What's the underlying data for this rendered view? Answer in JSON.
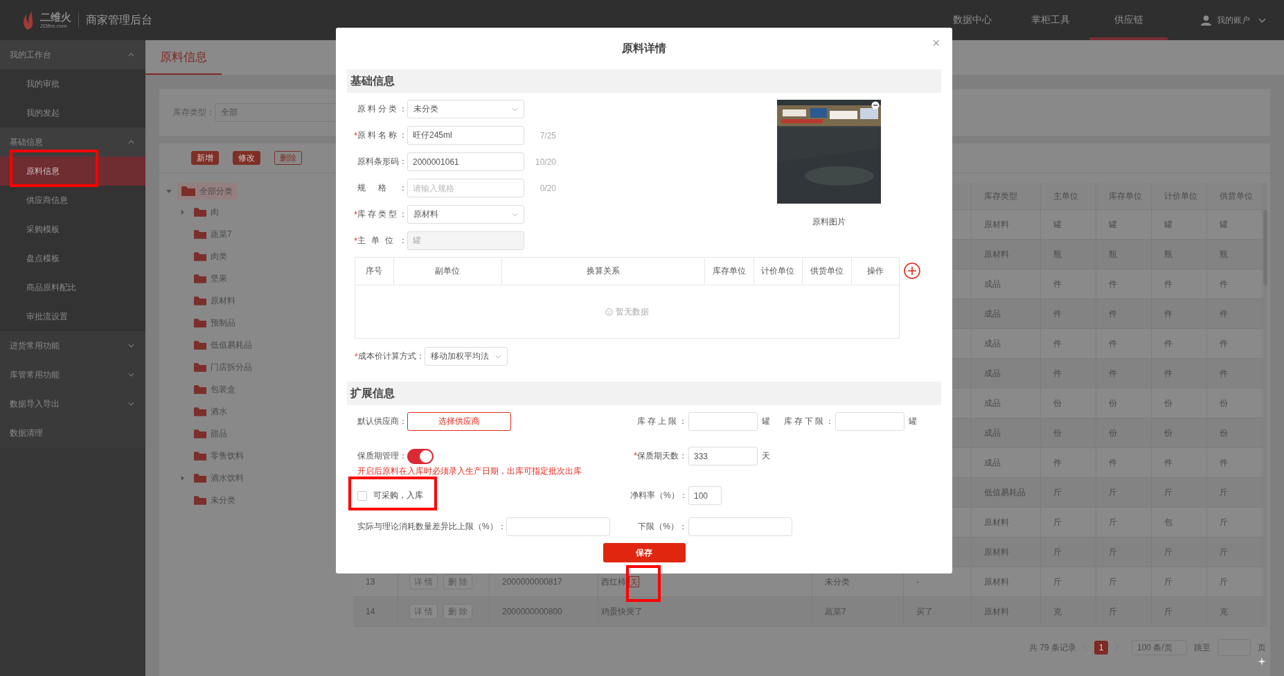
{
  "top_bar": {
    "logo_text": "二维火",
    "logo_sub": "2Dfire.com",
    "app_title": "商家管理后台",
    "nav": [
      {
        "label": "数据中心",
        "selected": false
      },
      {
        "label": "掌柜工具",
        "selected": false
      },
      {
        "label": "供应链",
        "selected": true
      }
    ],
    "account": "我的账户"
  },
  "sidebar": {
    "groups": [
      {
        "label": "我的工作台",
        "kind": "group",
        "expanded": true,
        "children": [
          {
            "label": "我的审批",
            "selected": false
          },
          {
            "label": "我的发起",
            "selected": false
          }
        ]
      },
      {
        "label": "基础信息",
        "kind": "group",
        "expanded": true,
        "children": [
          {
            "label": "原料信息",
            "selected": true
          },
          {
            "label": "供应商信息",
            "selected": false
          },
          {
            "label": "采购模板",
            "selected": false
          },
          {
            "label": "盘点模板",
            "selected": false
          },
          {
            "label": "商品原料配比",
            "selected": false
          },
          {
            "label": "审批流设置",
            "selected": false
          }
        ]
      },
      {
        "label": "进货常用功能",
        "kind": "group",
        "expanded": false
      },
      {
        "label": "库管常用功能",
        "kind": "group",
        "expanded": false
      },
      {
        "label": "数据导入导出",
        "kind": "group",
        "expanded": false
      },
      {
        "label": "数据清理",
        "kind": "link"
      }
    ]
  },
  "page_tab": "原料信息",
  "filter": {
    "label": "库存类型：",
    "value": "全部"
  },
  "toolbar": [
    {
      "label": "新增",
      "kind": "filled"
    },
    {
      "label": "修改",
      "kind": "filled"
    },
    {
      "label": "删除",
      "kind": "outline"
    }
  ],
  "tree": {
    "label": "全部分类",
    "expanded": true,
    "selected": true,
    "children": [
      {
        "label": "肉",
        "expandable": true,
        "selected": false
      },
      {
        "label": "蔬菜7",
        "expandable": false,
        "selected": false
      },
      {
        "label": "肉类",
        "expandable": false,
        "selected": false
      },
      {
        "label": "坚果",
        "expandable": false,
        "selected": false
      },
      {
        "label": "原材料",
        "expandable": false,
        "selected": false
      },
      {
        "label": "预制品",
        "expandable": false,
        "selected": false
      },
      {
        "label": "低值易耗品",
        "expandable": false,
        "selected": false
      },
      {
        "label": "门店拆分品",
        "expandable": false,
        "selected": false
      },
      {
        "label": "包装盒",
        "expandable": false,
        "selected": false
      },
      {
        "label": "酒水",
        "expandable": false,
        "selected": false
      },
      {
        "label": "甜品",
        "expandable": false,
        "selected": false
      },
      {
        "label": "零售饮料",
        "expandable": false,
        "selected": false
      },
      {
        "label": "酒水饮料",
        "expandable": true,
        "selected": false
      },
      {
        "label": "未分类",
        "expandable": false,
        "selected": false
      }
    ]
  },
  "table": {
    "columns": [
      "库存类型",
      "主单位",
      "库存单位",
      "计价单位",
      "供货单位"
    ],
    "rows": [
      {
        "cells": [
          "原材料",
          "罐",
          "罐",
          "罐",
          "罐"
        ]
      },
      {
        "cells": [
          "原材料",
          "瓶",
          "瓶",
          "瓶",
          "瓶"
        ]
      },
      {
        "cells": [
          "成品",
          "件",
          "件",
          "件",
          "件"
        ]
      },
      {
        "cells": [
          "成品",
          "件",
          "件",
          "件",
          "件"
        ]
      },
      {
        "cells": [
          "成品",
          "件",
          "件",
          "件",
          "件"
        ]
      },
      {
        "cells": [
          "成品",
          "件",
          "件",
          "件",
          "件"
        ]
      },
      {
        "cells": [
          "成品",
          "份",
          "份",
          "份",
          "份"
        ]
      },
      {
        "cells": [
          "成品",
          "份",
          "份",
          "份",
          "份"
        ]
      },
      {
        "cells": [
          "成品",
          "件",
          "件",
          "件",
          "件"
        ]
      },
      {
        "cells": [
          "低值易耗品",
          "斤",
          "斤",
          "斤",
          "斤"
        ]
      },
      {
        "cells": [
          "原材料",
          "斤",
          "斤",
          "包",
          "斤"
        ]
      },
      {
        "cells": [
          "原材料",
          "斤",
          "斤",
          "斤",
          "斤"
        ]
      },
      {
        "index": "13",
        "actions": [
          "详 情",
          "删 除"
        ],
        "barcode": "2000000000817",
        "name": "西红柿",
        "tag": "关",
        "category": "未分类",
        "column_6": "-",
        "cells": [
          "原材料",
          "斤",
          "斤",
          "斤",
          "斤"
        ]
      },
      {
        "index": "14",
        "actions": [
          "详 情",
          "删 除"
        ],
        "barcode": "2000000000800",
        "name": "鸡蛋快哭了",
        "category": "蔬菜7",
        "column_6": "买了",
        "cells": [
          "原材料",
          "克",
          "斤",
          "斤",
          "克"
        ]
      }
    ]
  },
  "pagination": {
    "total": "共 79 条记录",
    "page": "1",
    "page_size": "100 条/页",
    "jump_label": "跳至",
    "page_suffix": "页"
  },
  "modal": {
    "title": "原料详情",
    "close": "×",
    "basic": {
      "heading": "基础信息",
      "fields": [
        {
          "label": "原料分类：",
          "kind": "select",
          "value": "未分类"
        },
        {
          "mark": "*",
          "label": "原料名称：",
          "kind": "input",
          "value": "旺仔245ml",
          "counter": "7/25",
          "disabled": false
        },
        {
          "label": "原料条形码：",
          "kind": "input",
          "value": "2000001061",
          "counter": "10/20",
          "disabled": false
        },
        {
          "label": "规格：",
          "kind": "input",
          "placeholder": "请输入规格",
          "counter": "0/20"
        },
        {
          "mark": "*",
          "label": "库存类型：",
          "kind": "select",
          "value": "原材料"
        },
        {
          "mark": "*",
          "label": "主单位：",
          "kind": "input",
          "value": "罐",
          "disabled": true
        }
      ],
      "image": {
        "kind": "picture",
        "caption": "原料图片"
      }
    },
    "units_table": {
      "columns": [
        "序号",
        "副单位",
        "换算关系",
        "库存单位",
        "计价单位",
        "供货单位",
        "操作"
      ],
      "empty_text": "暂无数据"
    },
    "cost_method": {
      "mark": "*",
      "label": "成本价计算方式：",
      "value": "移动加权平均法"
    },
    "extended": {
      "heading": "扩展信息",
      "supplier": {
        "label": "默认供应商：",
        "button": "选择供应商"
      },
      "stock_upper": {
        "label": "库存上限：",
        "unit": "罐"
      },
      "stock_lower": {
        "label": "库存下限：",
        "unit": "罐"
      },
      "shelf_life": {
        "label": "保质期管理：",
        "on": true,
        "note": "开启后原料在入库时必须录入生产日期，出库可指定批次出库"
      },
      "shelf_days": {
        "mark": "*",
        "label": "保质期天数：",
        "value": "333",
        "unit": "天"
      },
      "purchasable": {
        "label": "可采购，入库",
        "checked": false
      },
      "net_rate": {
        "label": "净料率（%）：",
        "value": "100"
      },
      "diff_upper": {
        "label": "实际与理论消耗数量差异比上限（%）："
      },
      "diff_lower": {
        "label": "下限（%）："
      }
    },
    "save": "保存"
  }
}
